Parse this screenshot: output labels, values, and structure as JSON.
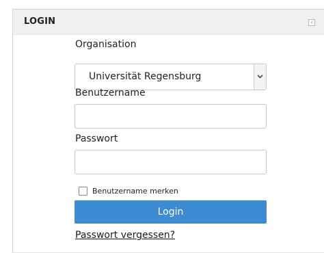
{
  "panel": {
    "title": "LOGIN"
  },
  "form": {
    "organisation_label": "Organisation",
    "organisation_value": "Universität Regensburg",
    "username_label": "Benutzername",
    "username_value": "",
    "password_label": "Passwort",
    "password_value": "",
    "remember_label": "Benutzername merken",
    "remember_checked": false,
    "login_button": "Login",
    "forgot_link": "Passwort vergessen?"
  },
  "icons": {
    "collapse": "collapse-left-icon",
    "dropdown": "chevron-down-icon"
  },
  "colors": {
    "login_button": "#3d8bd3",
    "header_bg": "#f0f0f0"
  }
}
